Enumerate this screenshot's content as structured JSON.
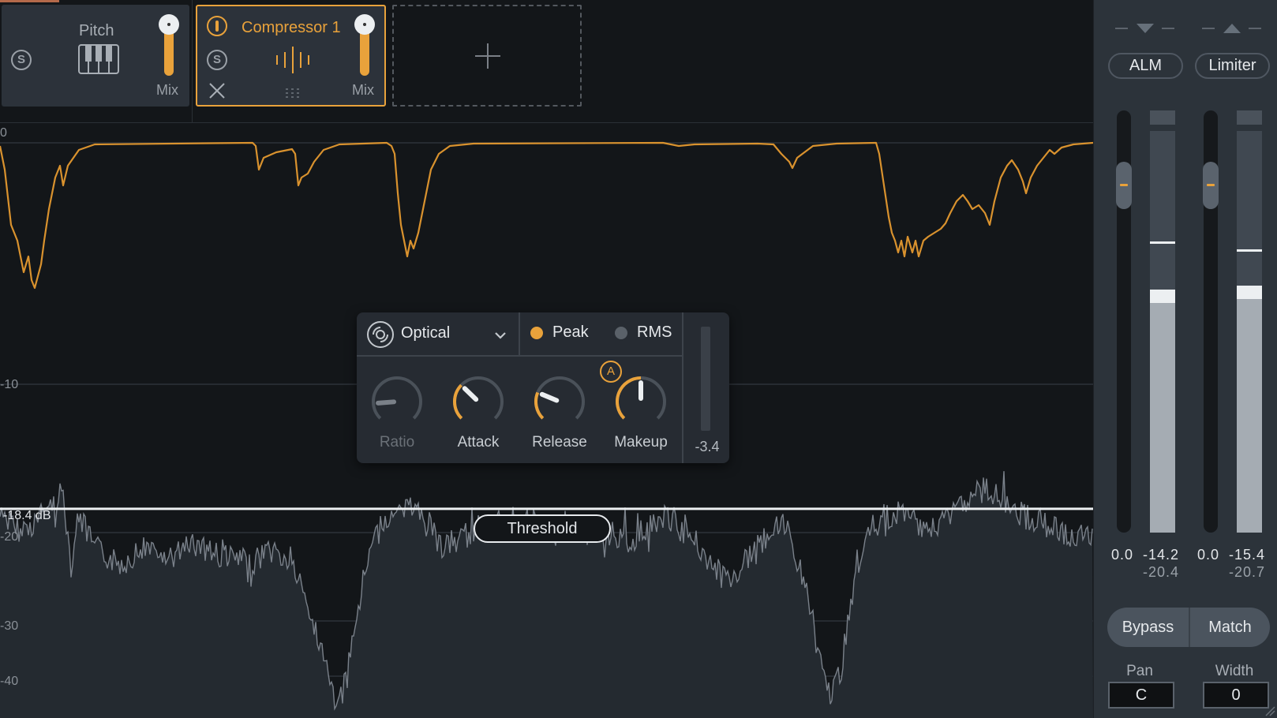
{
  "modules": [
    {
      "name": "Pitch",
      "solo_label": "S",
      "mix_label": "Mix",
      "icon": "piano-keys-icon",
      "selected": false,
      "mix_value": 1.0
    },
    {
      "name": "Compressor 1",
      "solo_label": "S",
      "mix_label": "Mix",
      "icon": "compressor-bars-icon",
      "power_icon": "power-icon",
      "remove_icon": "close-icon",
      "drag_icon": "drag-handle-icon",
      "selected": true,
      "mix_value": 1.0
    }
  ],
  "add_module": {
    "icon": "plus-icon"
  },
  "graph": {
    "y_axis_labels": [
      "0",
      "-10",
      "-20",
      "-30",
      "-40"
    ],
    "threshold_readout": "-18.4 dB",
    "threshold_label": "Threshold",
    "threshold_db": -18.4,
    "colors": {
      "gain_reduction": "#d9922e",
      "waveform_line": "#7a818a",
      "waveform_fill": "#242a30",
      "threshold_line": "#eceff1"
    }
  },
  "compressor": {
    "mode": "Optical",
    "mode_icon": "optical-mode-icon",
    "detection": [
      {
        "label": "Peak",
        "selected": true
      },
      {
        "label": "RMS",
        "selected": false
      }
    ],
    "knobs": [
      {
        "label": "Ratio",
        "value": 0.15,
        "enabled": false
      },
      {
        "label": "Attack",
        "value": 0.33,
        "enabled": true
      },
      {
        "label": "Release",
        "value": 0.25,
        "enabled": true
      },
      {
        "label": "Makeup",
        "value": 0.5,
        "enabled": true
      }
    ],
    "auto_badge": "A",
    "gain_reduction_value": "-3.4"
  },
  "output": {
    "alm_label": "ALM",
    "limiter_label": "Limiter",
    "meters": [
      {
        "fader_value": "0.0",
        "peak": "-14.2",
        "rms": "-20.4",
        "level": 0.58,
        "hold": 0.72
      },
      {
        "fader_value": "0.0",
        "peak": "-15.4",
        "rms": "-20.7",
        "level": 0.59,
        "hold": 0.7
      }
    ],
    "bypass_label": "Bypass",
    "match_label": "Match",
    "pan_label": "Pan",
    "pan_value": "C",
    "width_label": "Width",
    "width_value": "0",
    "accent_color": "#e9a23b"
  }
}
